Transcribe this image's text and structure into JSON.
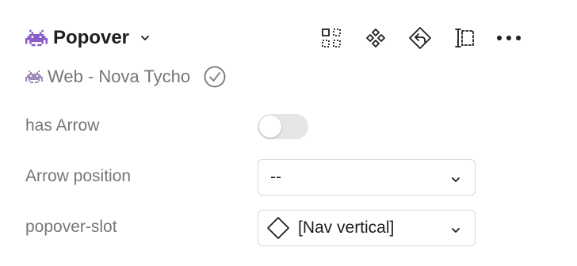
{
  "header": {
    "title": "Popover",
    "emoji": "space-invader-emoji",
    "tools": [
      "component-grid-icon",
      "component-diamonds-icon",
      "go-to-main-icon",
      "select-layer-icon",
      "more-options-icon"
    ]
  },
  "library": {
    "name": "Web - Nova Tycho",
    "status_icon": "verified-check-icon"
  },
  "properties": {
    "has_arrow": {
      "label": "has Arrow",
      "value": false
    },
    "arrow_position": {
      "label": "Arrow position",
      "value": "--"
    },
    "popover_slot": {
      "label": "popover-slot",
      "value": "[Nav vertical]",
      "icon": "instance-diamond-icon"
    }
  },
  "colors": {
    "text_primary": "#1e1e1e",
    "text_secondary": "#767676",
    "toggle_off": "#e6e6e6",
    "border": "#d9d9d9",
    "emoji_purple": "#8a5cc7"
  }
}
